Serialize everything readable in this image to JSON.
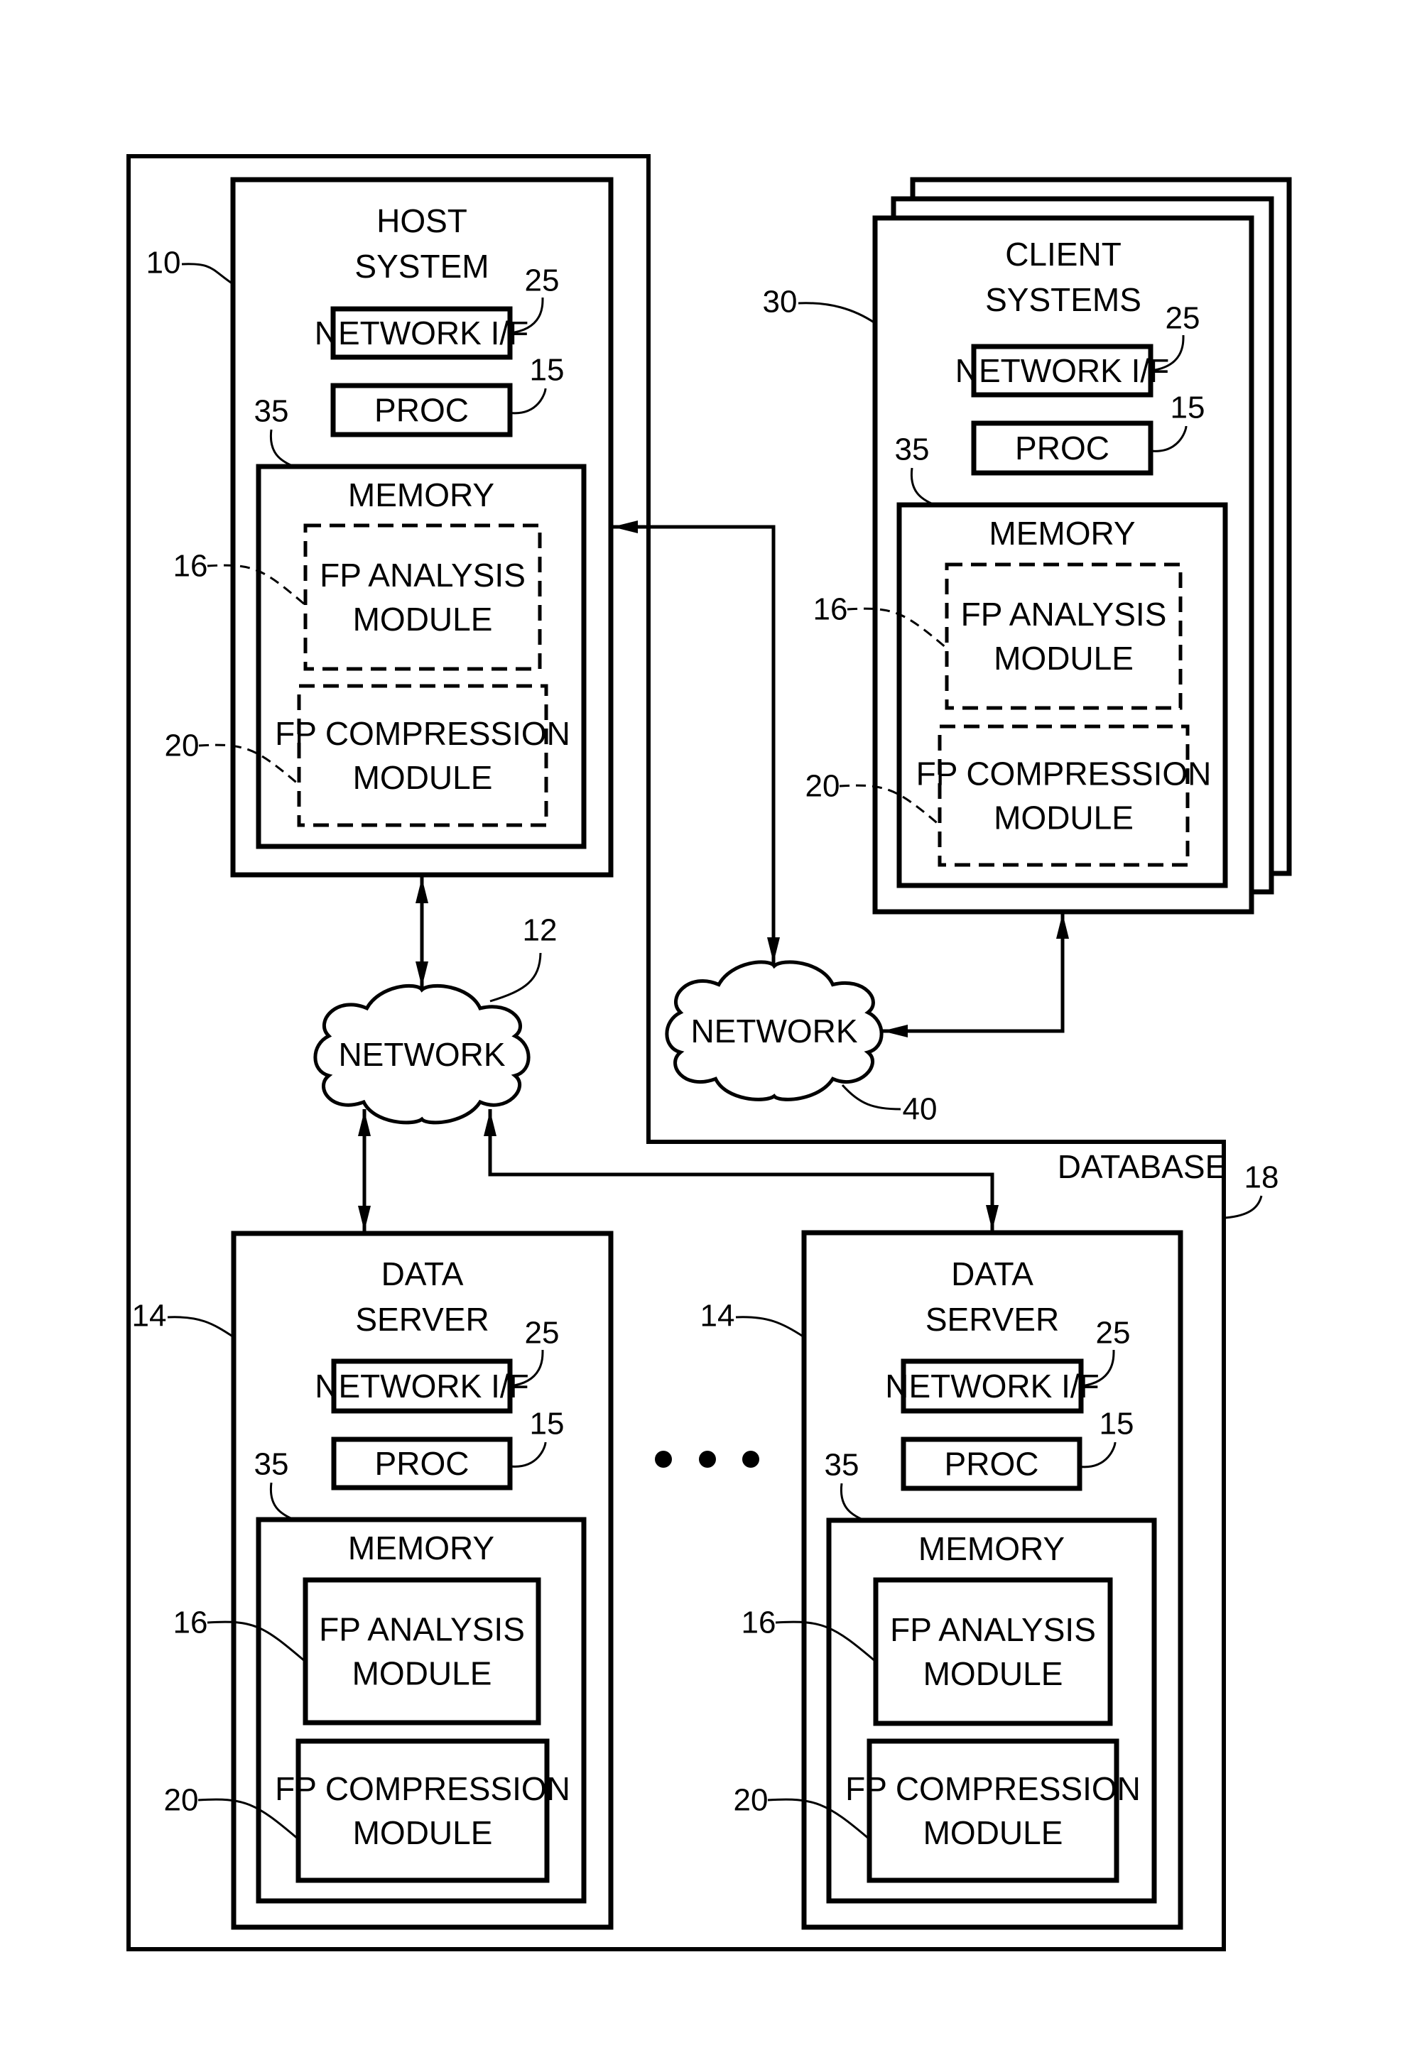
{
  "figure": {
    "database": {
      "label": "DATABASE",
      "ref": "18"
    },
    "host_system": {
      "title_lines": [
        "HOST",
        "SYSTEM"
      ],
      "ref": "10",
      "network_if": {
        "label": "NETWORK I/F",
        "ref": "25"
      },
      "proc": {
        "label": "PROC",
        "ref": "15"
      },
      "memory": {
        "label": "MEMORY",
        "ref": "35"
      },
      "fp_analysis": {
        "lines": [
          "FP ANALYSIS",
          "MODULE"
        ],
        "ref": "16",
        "style": "dashed"
      },
      "fp_compression": {
        "lines": [
          "FP COMPRESSION",
          "MODULE"
        ],
        "ref": "20",
        "style": "dashed"
      }
    },
    "client_systems": {
      "title_lines": [
        "CLIENT",
        "SYSTEMS"
      ],
      "ref": "30",
      "stacked_sheets": 3,
      "network_if": {
        "label": "NETWORK I/F",
        "ref": "25"
      },
      "proc": {
        "label": "PROC",
        "ref": "15"
      },
      "memory": {
        "label": "MEMORY",
        "ref": "35"
      },
      "fp_analysis": {
        "lines": [
          "FP ANALYSIS",
          "MODULE"
        ],
        "ref": "16",
        "style": "dashed"
      },
      "fp_compression": {
        "lines": [
          "FP COMPRESSION",
          "MODULE"
        ],
        "ref": "20",
        "style": "dashed"
      }
    },
    "data_servers": [
      {
        "title_lines": [
          "DATA",
          "SERVER"
        ],
        "ref": "14",
        "network_if": {
          "label": "NETWORK I/F",
          "ref": "25"
        },
        "proc": {
          "label": "PROC",
          "ref": "15"
        },
        "memory": {
          "label": "MEMORY",
          "ref": "35"
        },
        "fp_analysis": {
          "lines": [
            "FP ANALYSIS",
            "MODULE"
          ],
          "ref": "16",
          "style": "solid"
        },
        "fp_compression": {
          "lines": [
            "FP COMPRESSION",
            "MODULE"
          ],
          "ref": "20",
          "style": "solid"
        }
      },
      {
        "title_lines": [
          "DATA",
          "SERVER"
        ],
        "ref": "14",
        "network_if": {
          "label": "NETWORK I/F",
          "ref": "25"
        },
        "proc": {
          "label": "PROC",
          "ref": "15"
        },
        "memory": {
          "label": "MEMORY",
          "ref": "35"
        },
        "fp_analysis": {
          "lines": [
            "FP ANALYSIS",
            "MODULE"
          ],
          "ref": "16",
          "style": "solid"
        },
        "fp_compression": {
          "lines": [
            "FP COMPRESSION",
            "MODULE"
          ],
          "ref": "20",
          "style": "solid"
        }
      }
    ],
    "ellipsis": "• • •",
    "networks": [
      {
        "id": "internal",
        "label": "NETWORK",
        "ref": "12"
      },
      {
        "id": "external",
        "label": "NETWORK",
        "ref": "40"
      }
    ],
    "connections": [
      {
        "from": "host_system",
        "to": "network-12",
        "direction": "bidirectional"
      },
      {
        "from": "network-12",
        "to": "data_server_1",
        "direction": "bidirectional"
      },
      {
        "from": "network-12",
        "to": "data_server_2",
        "direction": "bidirectional"
      },
      {
        "from": "host_system",
        "to": "network-40",
        "direction": "bidirectional"
      },
      {
        "from": "client_systems",
        "to": "network-40",
        "direction": "bidirectional"
      }
    ]
  }
}
